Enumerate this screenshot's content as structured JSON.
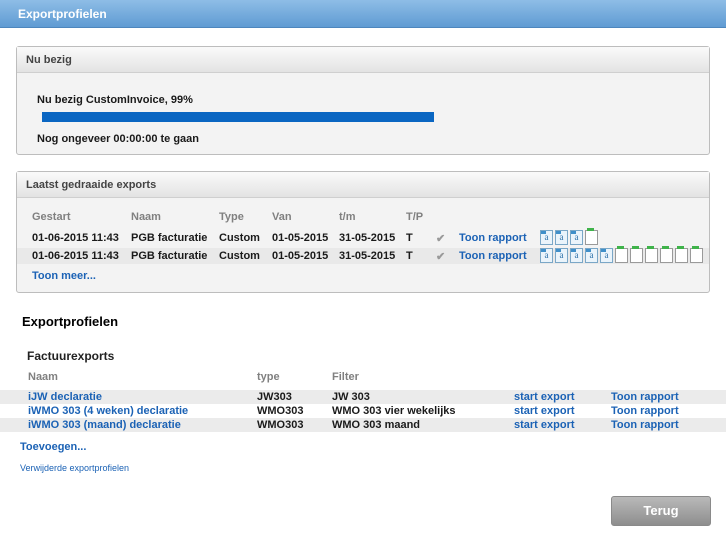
{
  "window": {
    "title": "Exportprofielen"
  },
  "busy": {
    "heading": "Nu bezig",
    "status": "Nu bezig CustomInvoice, 99%",
    "progress_fraction": 0.99,
    "remaining": "Nog ongeveer 00:00:00 te gaan"
  },
  "recent": {
    "heading": "Laatst gedraaide exports",
    "columns": [
      "Gestart",
      "Naam",
      "Type",
      "Van",
      "t/m",
      "T/P"
    ],
    "rows": [
      {
        "started": "01-06-2015 11:43",
        "name": "PGB facturatie",
        "type": "Custom",
        "from": "01-05-2015",
        "to": "31-05-2015",
        "tp": "T",
        "check": "✔",
        "report": "Toon rapport",
        "icons": [
          "file-icon",
          "file-icon",
          "file-icon",
          "blank-file-icon"
        ]
      },
      {
        "started": "01-06-2015 11:43",
        "name": "PGB facturatie",
        "type": "Custom",
        "from": "01-05-2015",
        "to": "31-05-2015",
        "tp": "T",
        "check": "✔",
        "report": "Toon rapport",
        "icons": [
          "file-icon",
          "file-icon",
          "file-icon",
          "file-icon",
          "file-icon",
          "blank-file-icon",
          "blank-file-icon",
          "blank-file-icon",
          "blank-file-icon",
          "blank-file-icon",
          "blank-file-icon"
        ]
      }
    ],
    "more": "Toon meer..."
  },
  "profiles": {
    "title": "Exportprofielen",
    "group": "Factuurexports",
    "columns": [
      "Naam",
      "type",
      "Filter"
    ],
    "rows": [
      {
        "name": "iJW declaratie",
        "type": "JW303",
        "filter": "JW 303",
        "start": "start export",
        "report": "Toon rapport"
      },
      {
        "name": "iWMO 303 (4 weken) declaratie",
        "type": "WMO303",
        "filter": "WMO 303 vier wekelijks",
        "start": "start export",
        "report": "Toon rapport"
      },
      {
        "name": "iWMO 303 (maand) declaratie",
        "type": "WMO303",
        "filter": "WMO 303 maand",
        "start": "start export",
        "report": "Toon rapport"
      }
    ],
    "add": "Toevoegen...",
    "deleted": "Verwijderde exportprofielen"
  },
  "footer": {
    "back_label": "Terug"
  },
  "colors": {
    "title_bar": "#6fa7db",
    "link": "#1b62b5",
    "progress": "#0a66c2"
  }
}
